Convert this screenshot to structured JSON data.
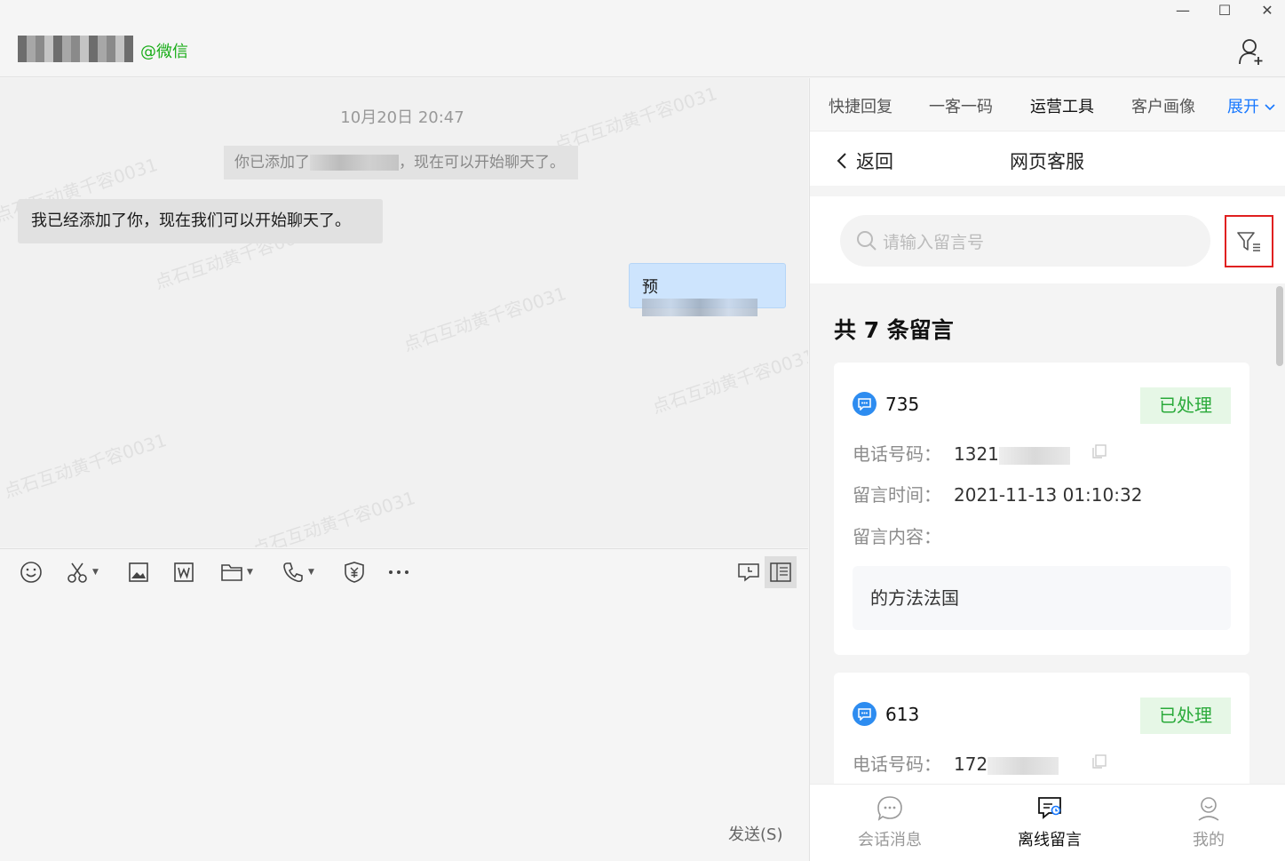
{
  "window": {
    "minimize": "—",
    "maximize": "☐",
    "close": "✕"
  },
  "header": {
    "contact_source": "@微信"
  },
  "chat": {
    "timestamp": "10月20日 20:47",
    "system_message_prefix": "你已添加了",
    "system_message_suffix": "，现在可以开始聊天了。",
    "messages": [
      {
        "side": "left",
        "text": "我已经添加了你，现在我们可以开始聊天了。"
      },
      {
        "side": "right",
        "text_prefix": "预"
      }
    ],
    "watermark": "点石互动黄千容0031"
  },
  "toolbar": {
    "send_label": "发送(S)"
  },
  "panel": {
    "tabs": [
      "快捷回复",
      "一客一码",
      "运营工具",
      "客户画像"
    ],
    "active_tab": "运营工具",
    "expand_label": "展开",
    "back_label": "返回",
    "title": "网页客服",
    "search_placeholder": "请输入留言号",
    "count_text": "共 7 条留言",
    "field_labels": {
      "phone": "电话号码：",
      "time": "留言时间：",
      "content": "留言内容："
    },
    "messages": [
      {
        "id": "735",
        "status": "已处理",
        "phone_prefix": "1321",
        "time": "2021-11-13 01:10:32",
        "content": "的方法法国"
      },
      {
        "id": "613",
        "status": "已处理",
        "phone_prefix": "172"
      }
    ],
    "bottom_nav": [
      {
        "label": "会话消息",
        "icon": "chat-bubble-icon"
      },
      {
        "label": "离线留言",
        "icon": "offline-message-icon"
      },
      {
        "label": "我的",
        "icon": "profile-icon"
      }
    ],
    "active_nav": "离线留言"
  },
  "colors": {
    "accent_blue": "#1677ff",
    "wechat_green": "#1aad19",
    "status_green": "#2aaa3a",
    "highlight_red": "#e02020"
  }
}
